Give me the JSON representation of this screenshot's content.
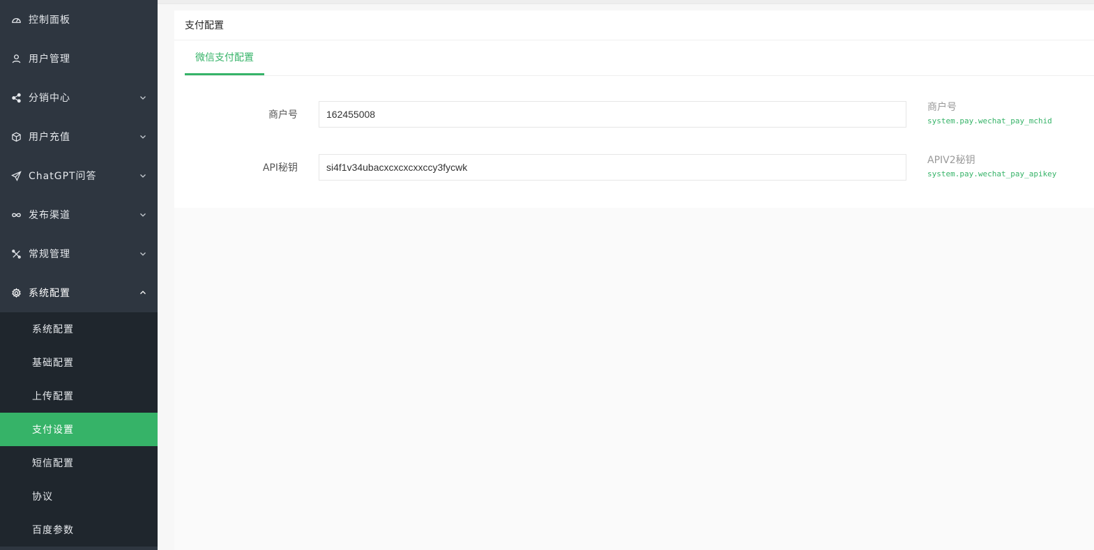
{
  "sidebar": {
    "items": [
      {
        "label": "控制面板",
        "icon": "dashboard-icon",
        "has_children": false
      },
      {
        "label": "用户管理",
        "icon": "user-icon",
        "has_children": true
      },
      {
        "label": "分销中心",
        "icon": "share-icon",
        "has_children": true
      },
      {
        "label": "用户充值",
        "icon": "cube-icon",
        "has_children": true
      },
      {
        "label": "ChatGPT问答",
        "icon": "send-icon",
        "has_children": true
      },
      {
        "label": "发布渠道",
        "icon": "infinity-icon",
        "has_children": true
      },
      {
        "label": "常规管理",
        "icon": "tools-icon",
        "has_children": true
      },
      {
        "label": "系统配置",
        "icon": "gear-icon",
        "has_children": true,
        "open": true
      }
    ],
    "submenu": [
      {
        "label": "系统配置"
      },
      {
        "label": "基础配置"
      },
      {
        "label": "上传配置"
      },
      {
        "label": "支付设置",
        "active": true
      },
      {
        "label": "短信配置"
      },
      {
        "label": "协议"
      },
      {
        "label": "百度参数"
      }
    ]
  },
  "card": {
    "title": "支付配置",
    "tabs": [
      {
        "label": "微信支付配置",
        "active": true
      }
    ],
    "fields": [
      {
        "label": "商户号",
        "value": "162455008",
        "help_title": "商户号",
        "help_key": "system.pay.wechat_pay_mchid"
      },
      {
        "label": "API秘钥",
        "value": "si4f1v34ubacxcxcxcxxccy3fycwk",
        "help_title": "APIV2秘钥",
        "help_key": "system.pay.wechat_pay_apikey"
      }
    ]
  },
  "colors": {
    "sidebar_bg": "#2e3640",
    "submenu_bg": "#1f262d",
    "accent": "#36b368"
  }
}
